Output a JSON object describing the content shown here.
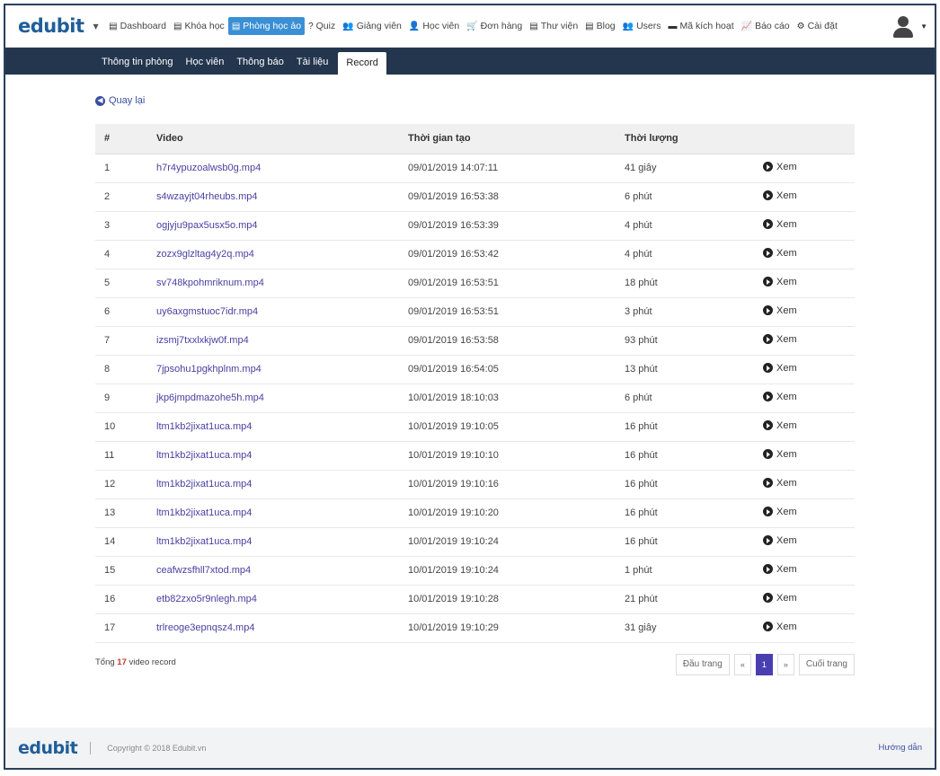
{
  "brand": {
    "name": "edubit"
  },
  "nav": [
    {
      "icon": "dashboard-icon",
      "glyph": "▤",
      "label": "Dashboard",
      "active": false
    },
    {
      "icon": "course-icon",
      "glyph": "▤",
      "label": "Khóa học",
      "active": false
    },
    {
      "icon": "classroom-icon",
      "glyph": "▤",
      "label": "Phòng học ảo",
      "active": true
    },
    {
      "icon": "quiz-icon",
      "glyph": "?",
      "label": "Quiz",
      "active": false
    },
    {
      "icon": "teachers-icon",
      "glyph": "👥",
      "label": "Giảng viên",
      "active": false
    },
    {
      "icon": "student-icon",
      "glyph": "👤",
      "label": "Học viên",
      "active": false
    },
    {
      "icon": "cart-icon",
      "glyph": "🛒",
      "label": "Đơn hàng",
      "active": false
    },
    {
      "icon": "library-icon",
      "glyph": "▤",
      "label": "Thư viện",
      "active": false
    },
    {
      "icon": "blog-icon",
      "glyph": "▤",
      "label": "Blog",
      "active": false
    },
    {
      "icon": "users-icon",
      "glyph": "👥",
      "label": "Users",
      "active": false
    },
    {
      "icon": "code-icon",
      "glyph": "▬",
      "label": "Mã kích hoạt",
      "active": false
    },
    {
      "icon": "report-icon",
      "glyph": "📈",
      "label": "Báo cáo",
      "active": false
    },
    {
      "icon": "settings-icon",
      "glyph": "⚙",
      "label": "Cài đặt",
      "active": false
    }
  ],
  "subnav": [
    {
      "label": "Thông tin phòng",
      "active": false
    },
    {
      "label": "Học viên",
      "active": false
    },
    {
      "label": "Thông báo",
      "active": false
    },
    {
      "label": "Tài liệu",
      "active": false
    },
    {
      "label": "Record",
      "active": true
    }
  ],
  "back_label": "Quay lại",
  "table": {
    "headers": [
      "#",
      "Video",
      "Thời gian tạo",
      "Thời lượng",
      ""
    ],
    "view_label": "Xem",
    "rows": [
      [
        "1",
        "h7r4ypuzoalwsb0g.mp4",
        "09/01/2019 14:07:11",
        "41 giây"
      ],
      [
        "2",
        "s4wzayjt04rheubs.mp4",
        "09/01/2019 16:53:38",
        "6 phút"
      ],
      [
        "3",
        "ogjyju9pax5usx5o.mp4",
        "09/01/2019 16:53:39",
        "4 phút"
      ],
      [
        "4",
        "zozx9glzltag4y2q.mp4",
        "09/01/2019 16:53:42",
        "4 phút"
      ],
      [
        "5",
        "sv748kpohmriknum.mp4",
        "09/01/2019 16:53:51",
        "18 phút"
      ],
      [
        "6",
        "uy6axgmstuoc7idr.mp4",
        "09/01/2019 16:53:51",
        "3 phút"
      ],
      [
        "7",
        "izsmj7txxlxkjw0f.mp4",
        "09/01/2019 16:53:58",
        "93 phút"
      ],
      [
        "8",
        "7jpsohu1pgkhplnm.mp4",
        "09/01/2019 16:54:05",
        "13 phút"
      ],
      [
        "9",
        "jkp6jmpdmazohe5h.mp4",
        "10/01/2019 18:10:03",
        "6 phút"
      ],
      [
        "10",
        "ltm1kb2jixat1uca.mp4",
        "10/01/2019 19:10:05",
        "16 phút"
      ],
      [
        "11",
        "ltm1kb2jixat1uca.mp4",
        "10/01/2019 19:10:10",
        "16 phút"
      ],
      [
        "12",
        "ltm1kb2jixat1uca.mp4",
        "10/01/2019 19:10:16",
        "16 phút"
      ],
      [
        "13",
        "ltm1kb2jixat1uca.mp4",
        "10/01/2019 19:10:20",
        "16 phút"
      ],
      [
        "14",
        "ltm1kb2jixat1uca.mp4",
        "10/01/2019 19:10:24",
        "16 phút"
      ],
      [
        "15",
        "ceafwzsfhll7xtod.mp4",
        "10/01/2019 19:10:24",
        "1 phút"
      ],
      [
        "16",
        "etb82zxo5r9nlegh.mp4",
        "10/01/2019 19:10:28",
        "21 phút"
      ],
      [
        "17",
        "trlreoge3epnqsz4.mp4",
        "10/01/2019 19:10:29",
        "31 giây"
      ]
    ]
  },
  "summary": {
    "prefix": "Tổng",
    "count": "17",
    "suffix": "video record"
  },
  "pagination": {
    "first": "Đầu trang",
    "prev": "«",
    "current": "1",
    "next": "»",
    "last": "Cuối trang"
  },
  "footer": {
    "copyright": "Copyright © 2018 Edubit.vn",
    "help": "Hướng dẫn"
  },
  "colors": {
    "brand": "#1f5e99",
    "active_nav": "#3b8fd4",
    "subnav_bg": "#23364e",
    "link": "#4b3ea0",
    "pager_active": "#4a3fb0",
    "count_highlight": "#c0392b"
  }
}
